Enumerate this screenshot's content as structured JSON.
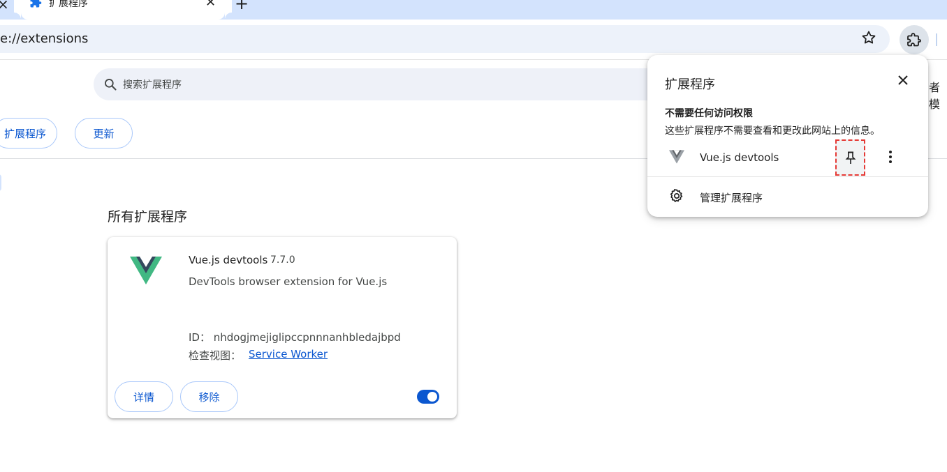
{
  "tab": {
    "title": "扩展程序"
  },
  "toolbar": {
    "url": "e://extensions"
  },
  "page": {
    "search_placeholder": "搜索扩展程序",
    "cut_off_text": "者模",
    "buttons": {
      "load_unpacked": "扩展程序",
      "update": "更新"
    },
    "section_title": "所有扩展程序",
    "extension": {
      "name": "Vue.js devtools",
      "version": "7.7.0",
      "description": "DevTools browser extension for Vue.js",
      "id": "ID：  nhdogjmejiglipccpnnnanhbledajbpd",
      "inspect_label": "检查视图：",
      "inspect_link": "Service Worker",
      "details": "详情",
      "remove": "移除",
      "enabled": true
    }
  },
  "popup": {
    "title": "扩展程序",
    "section": "不需要任何访问权限",
    "description": "这些扩展程序不需要查看和更改此网站上的信息。",
    "item_name": "Vue.js devtools",
    "manage": "管理扩展程序"
  },
  "colors": {
    "accent": "#0b57d0",
    "tabstrip": "#d3e3fd",
    "vue_green": "#41b883",
    "vue_dark": "#34495e",
    "highlight": "#e53935"
  }
}
